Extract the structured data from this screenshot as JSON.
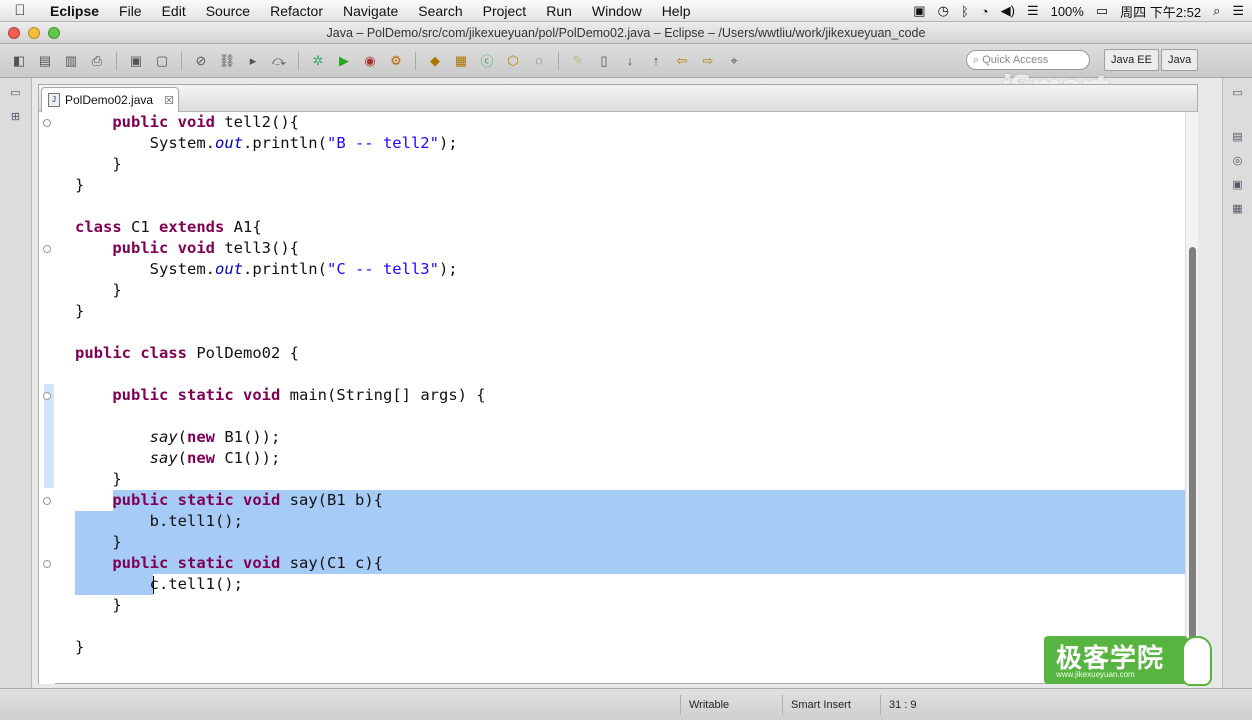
{
  "menubar": {
    "apple": "",
    "items": [
      "Eclipse",
      "File",
      "Edit",
      "Source",
      "Refactor",
      "Navigate",
      "Search",
      "Project",
      "Run",
      "Window",
      "Help"
    ],
    "battery": "100%",
    "clock": "周四 下午2:52"
  },
  "window": {
    "title": "Java – PolDemo/src/com/jikexueyuan/pol/PolDemo02.java – Eclipse – /Users/wwtliu/work/jikexueyuan_code"
  },
  "toolbar": {
    "quick_access_placeholder": "Quick Access",
    "perspectives": [
      "Java EE",
      "Java"
    ]
  },
  "watermark": "iSmart",
  "editor": {
    "tab_label": "PolDemo02.java",
    "tab_close": "☒",
    "lines": [
      {
        "indent": "    ",
        "parts": [
          [
            "kw",
            "public"
          ],
          [
            "t",
            " "
          ],
          [
            "kw",
            "void"
          ],
          [
            "t",
            " tell2(){"
          ]
        ]
      },
      {
        "indent": "        ",
        "parts": [
          [
            "t",
            "System."
          ],
          [
            "fld",
            "out"
          ],
          [
            "t",
            ".println("
          ],
          [
            "str",
            "\"B -- tell2\""
          ],
          [
            "t",
            ");"
          ]
        ]
      },
      {
        "indent": "    ",
        "parts": [
          [
            "t",
            "}"
          ]
        ]
      },
      {
        "indent": "",
        "parts": [
          [
            "t",
            "}"
          ]
        ]
      },
      {
        "indent": "",
        "parts": [
          [
            "t",
            ""
          ]
        ]
      },
      {
        "indent": "",
        "parts": [
          [
            "kw",
            "class"
          ],
          [
            "t",
            " C1 "
          ],
          [
            "kw",
            "extends"
          ],
          [
            "t",
            " A1{"
          ]
        ]
      },
      {
        "indent": "    ",
        "parts": [
          [
            "kw",
            "public"
          ],
          [
            "t",
            " "
          ],
          [
            "kw",
            "void"
          ],
          [
            "t",
            " tell3(){"
          ]
        ]
      },
      {
        "indent": "        ",
        "parts": [
          [
            "t",
            "System."
          ],
          [
            "fld",
            "out"
          ],
          [
            "t",
            ".println("
          ],
          [
            "str",
            "\"C -- tell3\""
          ],
          [
            "t",
            ");"
          ]
        ]
      },
      {
        "indent": "    ",
        "parts": [
          [
            "t",
            "}"
          ]
        ]
      },
      {
        "indent": "",
        "parts": [
          [
            "t",
            "}"
          ]
        ]
      },
      {
        "indent": "",
        "parts": [
          [
            "t",
            ""
          ]
        ]
      },
      {
        "indent": "",
        "parts": [
          [
            "kw",
            "public"
          ],
          [
            "t",
            " "
          ],
          [
            "kw",
            "class"
          ],
          [
            "t",
            " PolDemo02 {"
          ]
        ]
      },
      {
        "indent": "",
        "parts": [
          [
            "t",
            ""
          ]
        ]
      },
      {
        "indent": "    ",
        "parts": [
          [
            "kw",
            "public"
          ],
          [
            "t",
            " "
          ],
          [
            "kw",
            "static"
          ],
          [
            "t",
            " "
          ],
          [
            "kw",
            "void"
          ],
          [
            "t",
            " main(String[] args) {"
          ]
        ]
      },
      {
        "indent": "",
        "parts": [
          [
            "t",
            ""
          ]
        ]
      },
      {
        "indent": "        ",
        "parts": [
          [
            "sm",
            "say"
          ],
          [
            "t",
            "("
          ],
          [
            "kw",
            "new"
          ],
          [
            "t",
            " B1());"
          ]
        ]
      },
      {
        "indent": "        ",
        "parts": [
          [
            "sm",
            "say"
          ],
          [
            "t",
            "("
          ],
          [
            "kw",
            "new"
          ],
          [
            "t",
            " C1());"
          ]
        ]
      },
      {
        "indent": "    ",
        "parts": [
          [
            "t",
            "}"
          ]
        ]
      },
      {
        "indent": "    ",
        "parts": [
          [
            "kw",
            "public"
          ],
          [
            "t",
            " "
          ],
          [
            "kw",
            "static"
          ],
          [
            "t",
            " "
          ],
          [
            "kw",
            "void"
          ],
          [
            "t",
            " say(B1 b){"
          ]
        ]
      },
      {
        "indent": "        ",
        "parts": [
          [
            "t",
            "b.tell1();"
          ]
        ]
      },
      {
        "indent": "    ",
        "parts": [
          [
            "t",
            "}"
          ]
        ]
      },
      {
        "indent": "    ",
        "parts": [
          [
            "kw",
            "public"
          ],
          [
            "t",
            " "
          ],
          [
            "kw",
            "static"
          ],
          [
            "t",
            " "
          ],
          [
            "kw",
            "void"
          ],
          [
            "t",
            " say(C1 c){"
          ]
        ]
      },
      {
        "indent": "        ",
        "parts": [
          [
            "t",
            "c.tell1();"
          ]
        ]
      },
      {
        "indent": "    ",
        "parts": [
          [
            "t",
            "}"
          ]
        ]
      },
      {
        "indent": "",
        "parts": [
          [
            "t",
            ""
          ]
        ]
      },
      {
        "indent": "",
        "parts": [
          [
            "t",
            "}"
          ]
        ]
      }
    ]
  },
  "statusbar": {
    "writable": "Writable",
    "insert_mode": "Smart Insert",
    "position": "31 : 9"
  },
  "logo": {
    "text": "极客学院",
    "url": "www.jikexueyuan.com"
  },
  "colors": {
    "selection": "#a6cbf6",
    "keyword": "#7f0055",
    "field": "#0000c0",
    "string": "#2a00ff",
    "logo_green": "#58b440"
  }
}
